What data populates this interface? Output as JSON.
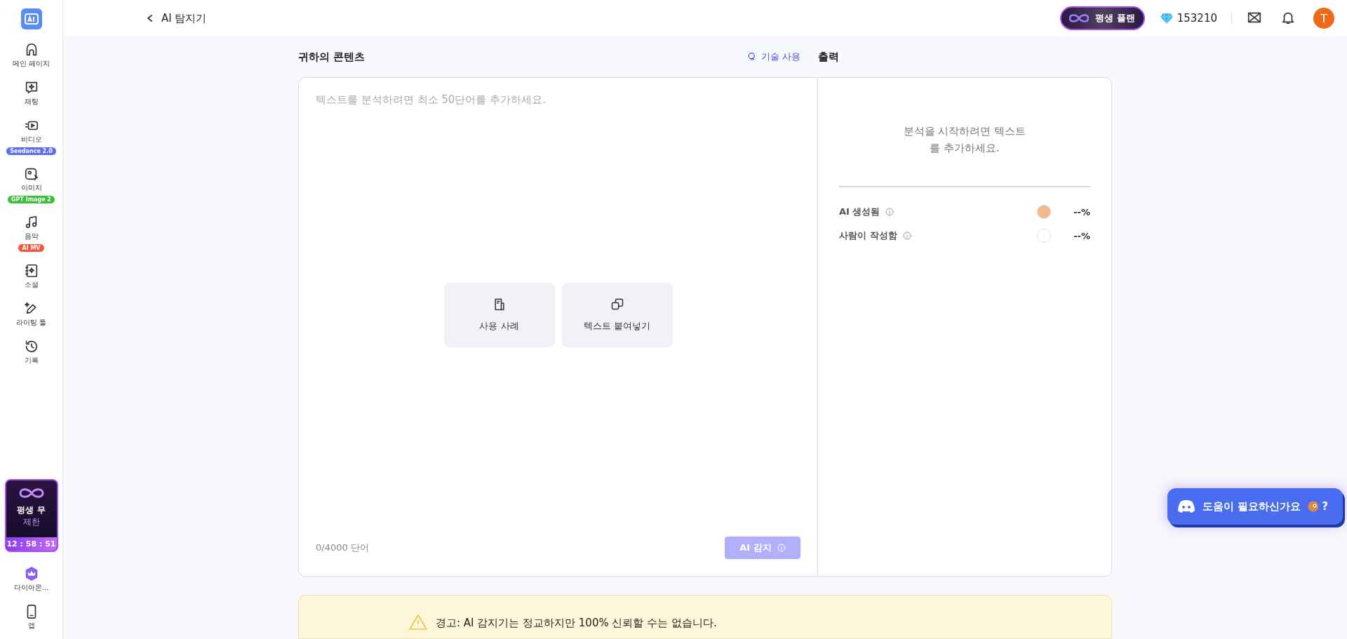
{
  "sidebar": {
    "items": [
      {
        "kind": "home",
        "label": "메인 페이지",
        "selected": false
      },
      {
        "kind": "chat",
        "label": "채팅",
        "selected": false
      },
      {
        "kind": "video",
        "label": "비디오",
        "selected": false,
        "badge": {
          "text": "Seedance 2.0",
          "color": "#5b6ef5"
        }
      },
      {
        "kind": "image",
        "label": "이미지",
        "selected": false,
        "badge": {
          "text": "GPT Image 2",
          "color": "#3cbf3a"
        }
      },
      {
        "kind": "music",
        "label": "음악",
        "selected": false,
        "badge": {
          "text": "AI MV",
          "color": "#f4573a"
        }
      },
      {
        "kind": "novel",
        "label": "소설",
        "selected": false
      },
      {
        "kind": "write",
        "label": "라이팅 툴",
        "selected": false
      },
      {
        "kind": "history",
        "label": "기록",
        "selected": false
      }
    ],
    "promo": {
      "title": "평생 무",
      "subtitle": "제한",
      "timer": "12 : 58 : 51"
    },
    "bottom_items": [
      {
        "kind": "crown",
        "label": "다이아몬..."
      },
      {
        "kind": "phone",
        "label": "앱"
      }
    ]
  },
  "header": {
    "back_label": "AI 탐지기",
    "plan": "평생 플랜",
    "gems": "153210",
    "avatar": "T"
  },
  "input_panel": {
    "title": "귀하의 콘텐츠",
    "tips_link": "기술 사용",
    "placeholder": "텍스트를 분석하려면 최소 50단어를 추가하세요.",
    "actions": [
      {
        "kind": "sample",
        "label": "사용 사례"
      },
      {
        "kind": "paste",
        "label": "텍스트 붙여넣기"
      }
    ],
    "word_count": "0/4000 단어",
    "detect_button": {
      "label": "AI 감지",
      "disabled": true
    }
  },
  "output_panel": {
    "title": "출력",
    "message": "분석을 시작하려면 텍스트\n를 추가하세요.",
    "results": [
      {
        "label": "AI 생성됨",
        "value": "--%",
        "color": "#f5b987"
      },
      {
        "label": "사람이 작성함",
        "value": "--%",
        "color": "#ffffff"
      }
    ]
  },
  "warning": {
    "text": "경고: AI 감지기는 정교하지만 100% 신뢰할 수는 없습니다."
  },
  "help_button": {
    "label": "도움이 필요하신가요",
    "suffix": "?"
  }
}
